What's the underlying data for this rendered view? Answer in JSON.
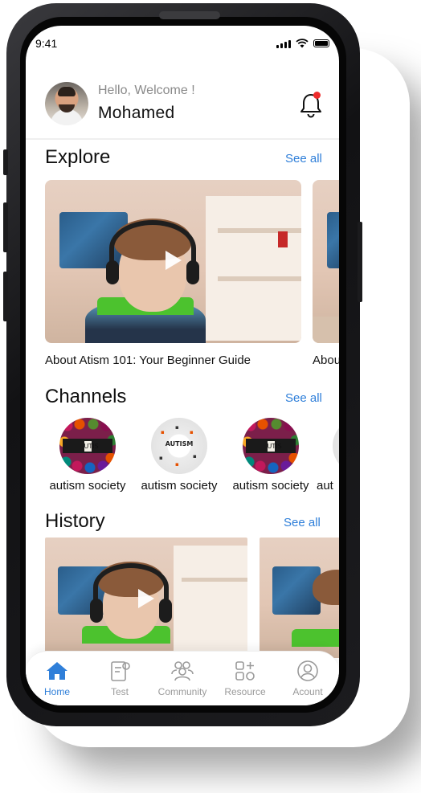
{
  "status_bar": {
    "time": "9:41"
  },
  "header": {
    "greeting": "Hello, Welcome !",
    "username": "Mohamed"
  },
  "explore": {
    "title": "Explore",
    "see_all": "See all",
    "items": [
      {
        "caption": "About Atism 101: Your Beginner Guide"
      },
      {
        "caption": "Abou"
      }
    ]
  },
  "channels": {
    "title": "Channels",
    "see_all": "See all",
    "items": [
      {
        "name": "autism society",
        "logo_text": "UTIS"
      },
      {
        "name": "autism society",
        "logo_text": "AUTISM"
      },
      {
        "name": "autism society",
        "logo_text": "UTIS"
      },
      {
        "name": "aut"
      }
    ]
  },
  "history": {
    "title": "History",
    "see_all": "See all"
  },
  "bottom_nav": {
    "items": [
      {
        "label": "Home",
        "icon": "home-icon",
        "active": true
      },
      {
        "label": "Test",
        "icon": "test-icon",
        "active": false
      },
      {
        "label": "Community",
        "icon": "community-icon",
        "active": false
      },
      {
        "label": "Resource",
        "icon": "resource-icon",
        "active": false
      },
      {
        "label": "Acount",
        "icon": "account-icon",
        "active": false
      }
    ]
  },
  "colors": {
    "accent": "#2f7fd9",
    "notification": "#ee2c2c",
    "text": "#111111"
  }
}
